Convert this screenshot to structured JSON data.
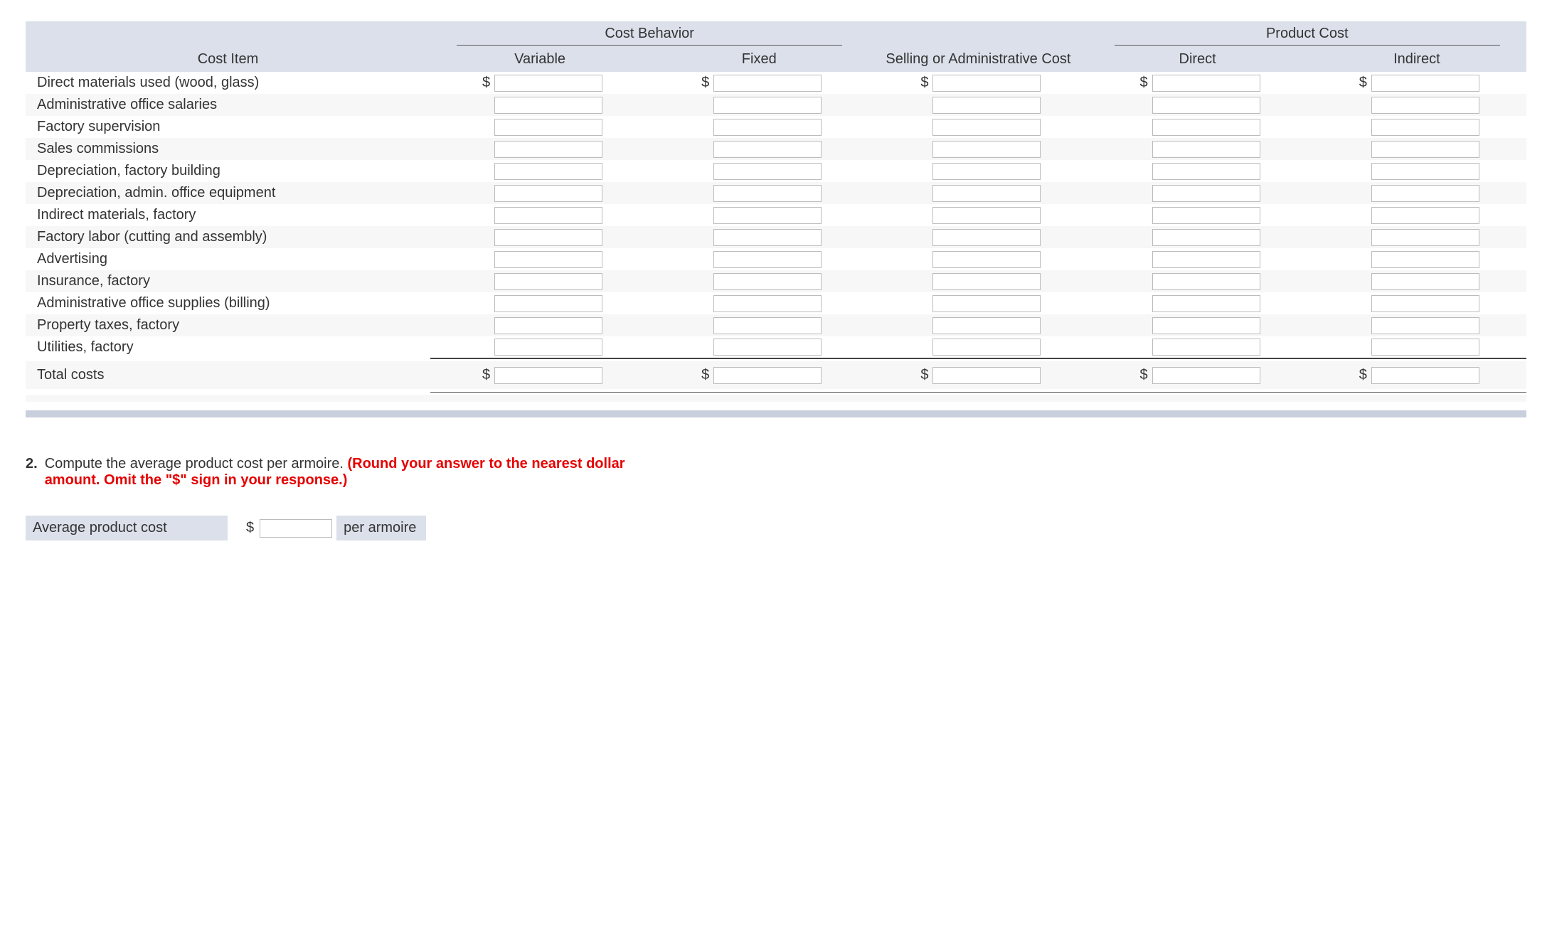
{
  "table": {
    "groups": {
      "cost_behavior": "Cost Behavior",
      "selling_admin": "Selling or Administrative Cost",
      "product_cost": "Product Cost"
    },
    "columns": {
      "cost_item": "Cost Item",
      "variable": "Variable",
      "fixed": "Fixed",
      "direct": "Direct",
      "indirect": "Indirect"
    },
    "dollar_sign": "$",
    "rows": [
      {
        "label": "Direct materials used (wood, glass)",
        "show_sym": true
      },
      {
        "label": "Administrative office salaries",
        "show_sym": false
      },
      {
        "label": "Factory supervision",
        "show_sym": false
      },
      {
        "label": "Sales commissions",
        "show_sym": false
      },
      {
        "label": "Depreciation, factory building",
        "show_sym": false
      },
      {
        "label": "Depreciation, admin. office equipment",
        "show_sym": false
      },
      {
        "label": "Indirect materials, factory",
        "show_sym": false
      },
      {
        "label": "Factory labor (cutting and assembly)",
        "show_sym": false
      },
      {
        "label": "Advertising",
        "show_sym": false
      },
      {
        "label": "Insurance, factory",
        "show_sym": false
      },
      {
        "label": "Administrative office supplies (billing)",
        "show_sym": false
      },
      {
        "label": "Property taxes, factory",
        "show_sym": false
      },
      {
        "label": "Utilities, factory",
        "show_sym": false
      }
    ],
    "total_label": "Total costs"
  },
  "question": {
    "number": "2.",
    "text": "Compute the average product cost per armoire. ",
    "hint": "(Round your answer to the nearest dollar amount. Omit the \"$\" sign in your response.)"
  },
  "average": {
    "label": "Average product cost",
    "sym": "$",
    "value": "",
    "unit": "per armoire"
  }
}
